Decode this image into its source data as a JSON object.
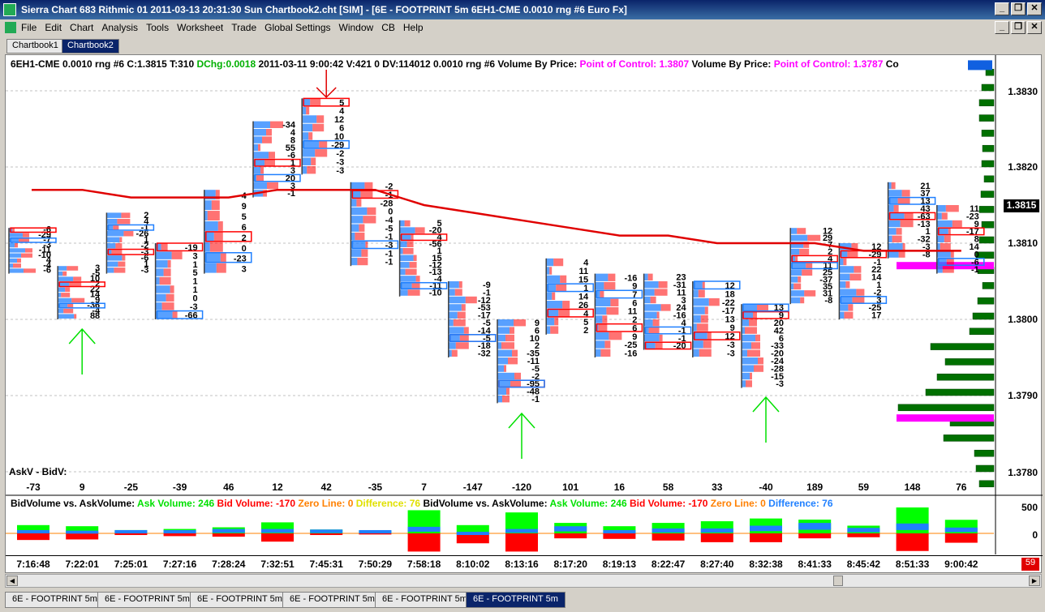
{
  "window": {
    "title": "Sierra Chart 683 Rithmic 01 2011-03-13  20:31:30  Sun   Chartbook2.cht [SIM] - [6E - FOOTPRINT 5m  6EH1-CME  0.0010 rng  #6  Euro Fx]",
    "minimize": "_",
    "restore": "❐",
    "close": "✕"
  },
  "menu": [
    "File",
    "Edit",
    "Chart",
    "Analysis",
    "Tools",
    "Worksheet",
    "Trade",
    "Global Settings",
    "Window",
    "CB",
    "Help"
  ],
  "chartbook_tabs": [
    {
      "label": "Chartbook1",
      "active": false
    },
    {
      "label": "Chartbook2",
      "active": true
    }
  ],
  "header": {
    "main": "6EH1-CME  0.0010 rng  #6 C:1.3815 T:310 ",
    "dchg": "DChg:0.0018",
    "rest": " 2011-03-11  9:00:42 V:421 0 DV:114012 0.0010 rng #6  Volume By Price: ",
    "poc1": "Point of Control: 1.3807",
    "mid": "  Volume By Price: ",
    "poc2": "Point of Control: 1.3787",
    "tail": "  Co"
  },
  "price_axis": [
    "1.3830",
    "1.3820",
    "1.3810",
    "1.3800",
    "1.3790",
    "1.3780"
  ],
  "last_price": "1.3815",
  "askbid_label": "AskV - BidV:",
  "delta_values": [
    "-73",
    "9",
    "-25",
    "-39",
    "46",
    "12",
    "42",
    "-35",
    "7",
    "-147",
    "-120",
    "101",
    "16",
    "58",
    "33",
    "-40",
    "189",
    "59",
    "148",
    "76"
  ],
  "subgraph": {
    "title": "BidVolume vs. AskVolume:",
    "ask": "Ask Volume: 246",
    "bid": "Bid Volume: -170",
    "zero": "Zero Line: 0",
    "diff1": "Difference: 76",
    "diff2": "Difference: 76",
    "axis_500": "500",
    "axis_0": "0"
  },
  "time_axis": [
    "7:16:48",
    "7:22:01",
    "7:25:01",
    "7:27:16",
    "7:28:24",
    "7:32:51",
    "7:45:31",
    "7:50:29",
    "7:58:18",
    "8:10:02",
    "8:13:16",
    "8:17:20",
    "8:19:13",
    "8:22:47",
    "8:27:40",
    "8:32:38",
    "8:41:33",
    "8:45:42",
    "8:51:33",
    "9:00:42"
  ],
  "bar_count": "59",
  "bottom_tabs": [
    {
      "label": "6E - FOOTPRINT 5m",
      "active": false
    },
    {
      "label": "6E - FOOTPRINT 5m",
      "active": false
    },
    {
      "label": "6E - FOOTPRINT 5m",
      "active": false
    },
    {
      "label": "6E - FOOTPRINT 5m",
      "active": false
    },
    {
      "label": "6E - FOOTPRINT 5m",
      "active": false
    },
    {
      "label": "6E - FOOTPRINT 5m",
      "active": true
    }
  ],
  "colors": {
    "ask": "#ff0000",
    "bid": "#2080ff",
    "vbp": "#007000",
    "poc": "#ff00ff",
    "ma": "#e00000",
    "arrow_up": "#00e000",
    "arrow_down": "#e00000"
  },
  "chart_data": {
    "type": "bar",
    "ylim": [
      1.3775,
      1.3835
    ],
    "categories": [
      "7:16:48",
      "7:22:01",
      "7:25:01",
      "7:27:16",
      "7:28:24",
      "7:32:51",
      "7:45:31",
      "7:50:29",
      "7:58:18",
      "8:10:02",
      "8:13:16",
      "8:17:20",
      "8:19:13",
      "8:22:47",
      "8:27:40",
      "8:32:38",
      "8:41:33",
      "8:45:42",
      "8:51:33",
      "9:00:42"
    ],
    "bars": [
      {
        "high": 1.3812,
        "low": 1.3806,
        "labels": [
          "-6",
          "-29",
          "-7",
          "-3",
          "-11",
          "-10",
          "4",
          "-4",
          "-6"
        ]
      },
      {
        "high": 1.3807,
        "low": 1.38,
        "labels": [
          "3",
          "-5",
          "10",
          "2",
          "22",
          "14",
          "9",
          "-36",
          "-4",
          "88"
        ]
      },
      {
        "high": 1.3814,
        "low": 1.3806,
        "labels": [
          "2",
          "4",
          "-1",
          "-26",
          "1",
          "-2",
          "-3",
          "-6",
          "1",
          "-3"
        ]
      },
      {
        "high": 1.381,
        "low": 1.38,
        "labels": [
          "-19",
          "3",
          "1",
          "5",
          "1",
          "1",
          "0",
          "-3",
          "-66"
        ]
      },
      {
        "high": 1.3817,
        "low": 1.3806,
        "labels": [
          "4",
          "9",
          "5",
          "6",
          "2",
          "0",
          "-23",
          "3"
        ]
      },
      {
        "high": 1.3826,
        "low": 1.3816,
        "labels": [
          "-34",
          "4",
          "8",
          "55",
          "-6",
          "1",
          "3",
          "20",
          "3",
          "-1"
        ]
      },
      {
        "high": 1.3829,
        "low": 1.3819,
        "labels": [
          "5",
          "4",
          "12",
          "6",
          "10",
          "-29",
          "-2",
          "-3",
          "-3"
        ]
      },
      {
        "high": 1.3818,
        "low": 1.3807,
        "labels": [
          "-2",
          "-1",
          "-28",
          "0",
          "-4",
          "-5",
          "-1",
          "-3",
          "-1",
          "-1"
        ]
      },
      {
        "high": 1.3813,
        "low": 1.3803,
        "labels": [
          "5",
          "-20",
          "4",
          "-56",
          "1",
          "15",
          "-12",
          "-13",
          "-4",
          "-11",
          "-10"
        ]
      },
      {
        "high": 1.3805,
        "low": 1.3795,
        "labels": [
          "-9",
          "-1",
          "-12",
          "-53",
          "-17",
          "-5",
          "-14",
          "-5",
          "-18",
          "-32"
        ]
      },
      {
        "high": 1.38,
        "low": 1.3789,
        "labels": [
          "9",
          "6",
          "10",
          "2",
          "-35",
          "-11",
          "-5",
          "-2",
          "-95",
          "-48",
          "-1"
        ]
      },
      {
        "high": 1.3808,
        "low": 1.3798,
        "labels": [
          "4",
          "11",
          "15",
          "1",
          "14",
          "26",
          "4",
          "5",
          "2"
        ]
      },
      {
        "high": 1.3806,
        "low": 1.3795,
        "labels": [
          "-16",
          "9",
          "7",
          "6",
          "11",
          "2",
          "6",
          "9",
          "-25",
          "-16"
        ]
      },
      {
        "high": 1.3806,
        "low": 1.3796,
        "labels": [
          "23",
          "-31",
          "11",
          "3",
          "24",
          "-16",
          "4",
          "-1",
          "-1",
          "-20"
        ]
      },
      {
        "high": 1.3805,
        "low": 1.3795,
        "labels": [
          "12",
          "18",
          "-22",
          "-17",
          "13",
          "9",
          "12",
          "-3",
          "-3"
        ]
      },
      {
        "high": 1.3802,
        "low": 1.3791,
        "labels": [
          "13",
          "9",
          "20",
          "42",
          "6",
          "-33",
          "-20",
          "-24",
          "-28",
          "-15",
          "-3"
        ]
      },
      {
        "high": 1.3812,
        "low": 1.3802,
        "labels": [
          "12",
          "29",
          "7",
          "2",
          "4",
          "11",
          "25",
          "-37",
          "35",
          "31",
          "-8"
        ]
      },
      {
        "high": 1.381,
        "low": 1.38,
        "labels": [
          "12",
          "-29",
          "-1",
          "22",
          "14",
          "1",
          "-2",
          "3",
          "-25",
          "17"
        ]
      },
      {
        "high": 1.3818,
        "low": 1.3808,
        "labels": [
          "21",
          "37",
          "13",
          "43",
          "-63",
          "-13",
          "1",
          "-32",
          "-3",
          "-8"
        ]
      },
      {
        "high": 1.3815,
        "low": 1.3806,
        "labels": [
          "11",
          "-23",
          "9",
          "-17",
          "8",
          "14",
          "0",
          "-6",
          "-1"
        ]
      }
    ],
    "moving_average": [
      1.3817,
      1.3817,
      1.3816,
      1.3816,
      1.3816,
      1.3817,
      1.3817,
      1.3817,
      1.3815,
      1.3814,
      1.3813,
      1.3812,
      1.3811,
      1.3811,
      1.381,
      1.381,
      1.381,
      1.3809,
      1.3809,
      1.3809
    ],
    "delta": [
      -73,
      9,
      -25,
      -39,
      46,
      12,
      42,
      -35,
      7,
      -147,
      -120,
      101,
      16,
      58,
      33,
      -40,
      189,
      59,
      148,
      76
    ],
    "bid_ask_series": [
      {
        "name": "Ask Volume",
        "values": [
          150,
          130,
          60,
          80,
          110,
          200,
          70,
          50,
          420,
          150,
          380,
          190,
          130,
          190,
          220,
          270,
          250,
          140,
          470,
          246
        ]
      },
      {
        "name": "Bid Volume",
        "values": [
          -120,
          -110,
          -30,
          -50,
          -60,
          -150,
          -30,
          -20,
          -330,
          -180,
          -330,
          -90,
          -100,
          -130,
          -160,
          -160,
          -90,
          -70,
          -320,
          -170
        ]
      }
    ],
    "vbp_levels": [
      1.3832,
      1.383,
      1.3828,
      1.3826,
      1.3824,
      1.3822,
      1.382,
      1.3818,
      1.3816,
      1.3814,
      1.3812,
      1.381,
      1.3808,
      1.3806,
      1.3804,
      1.3802,
      1.38,
      1.3798,
      1.3796,
      1.3794,
      1.3792,
      1.379,
      1.3788,
      1.3786,
      1.3784,
      1.3782,
      1.378,
      1.3778
    ],
    "vbp_volumes": [
      10,
      15,
      18,
      18,
      15,
      14,
      15,
      12,
      16,
      18,
      15,
      18,
      22,
      20,
      14,
      20,
      26,
      30,
      78,
      60,
      70,
      84,
      118,
      54,
      62,
      24,
      22,
      18
    ],
    "poc": [
      1.3807,
      1.3787
    ]
  }
}
